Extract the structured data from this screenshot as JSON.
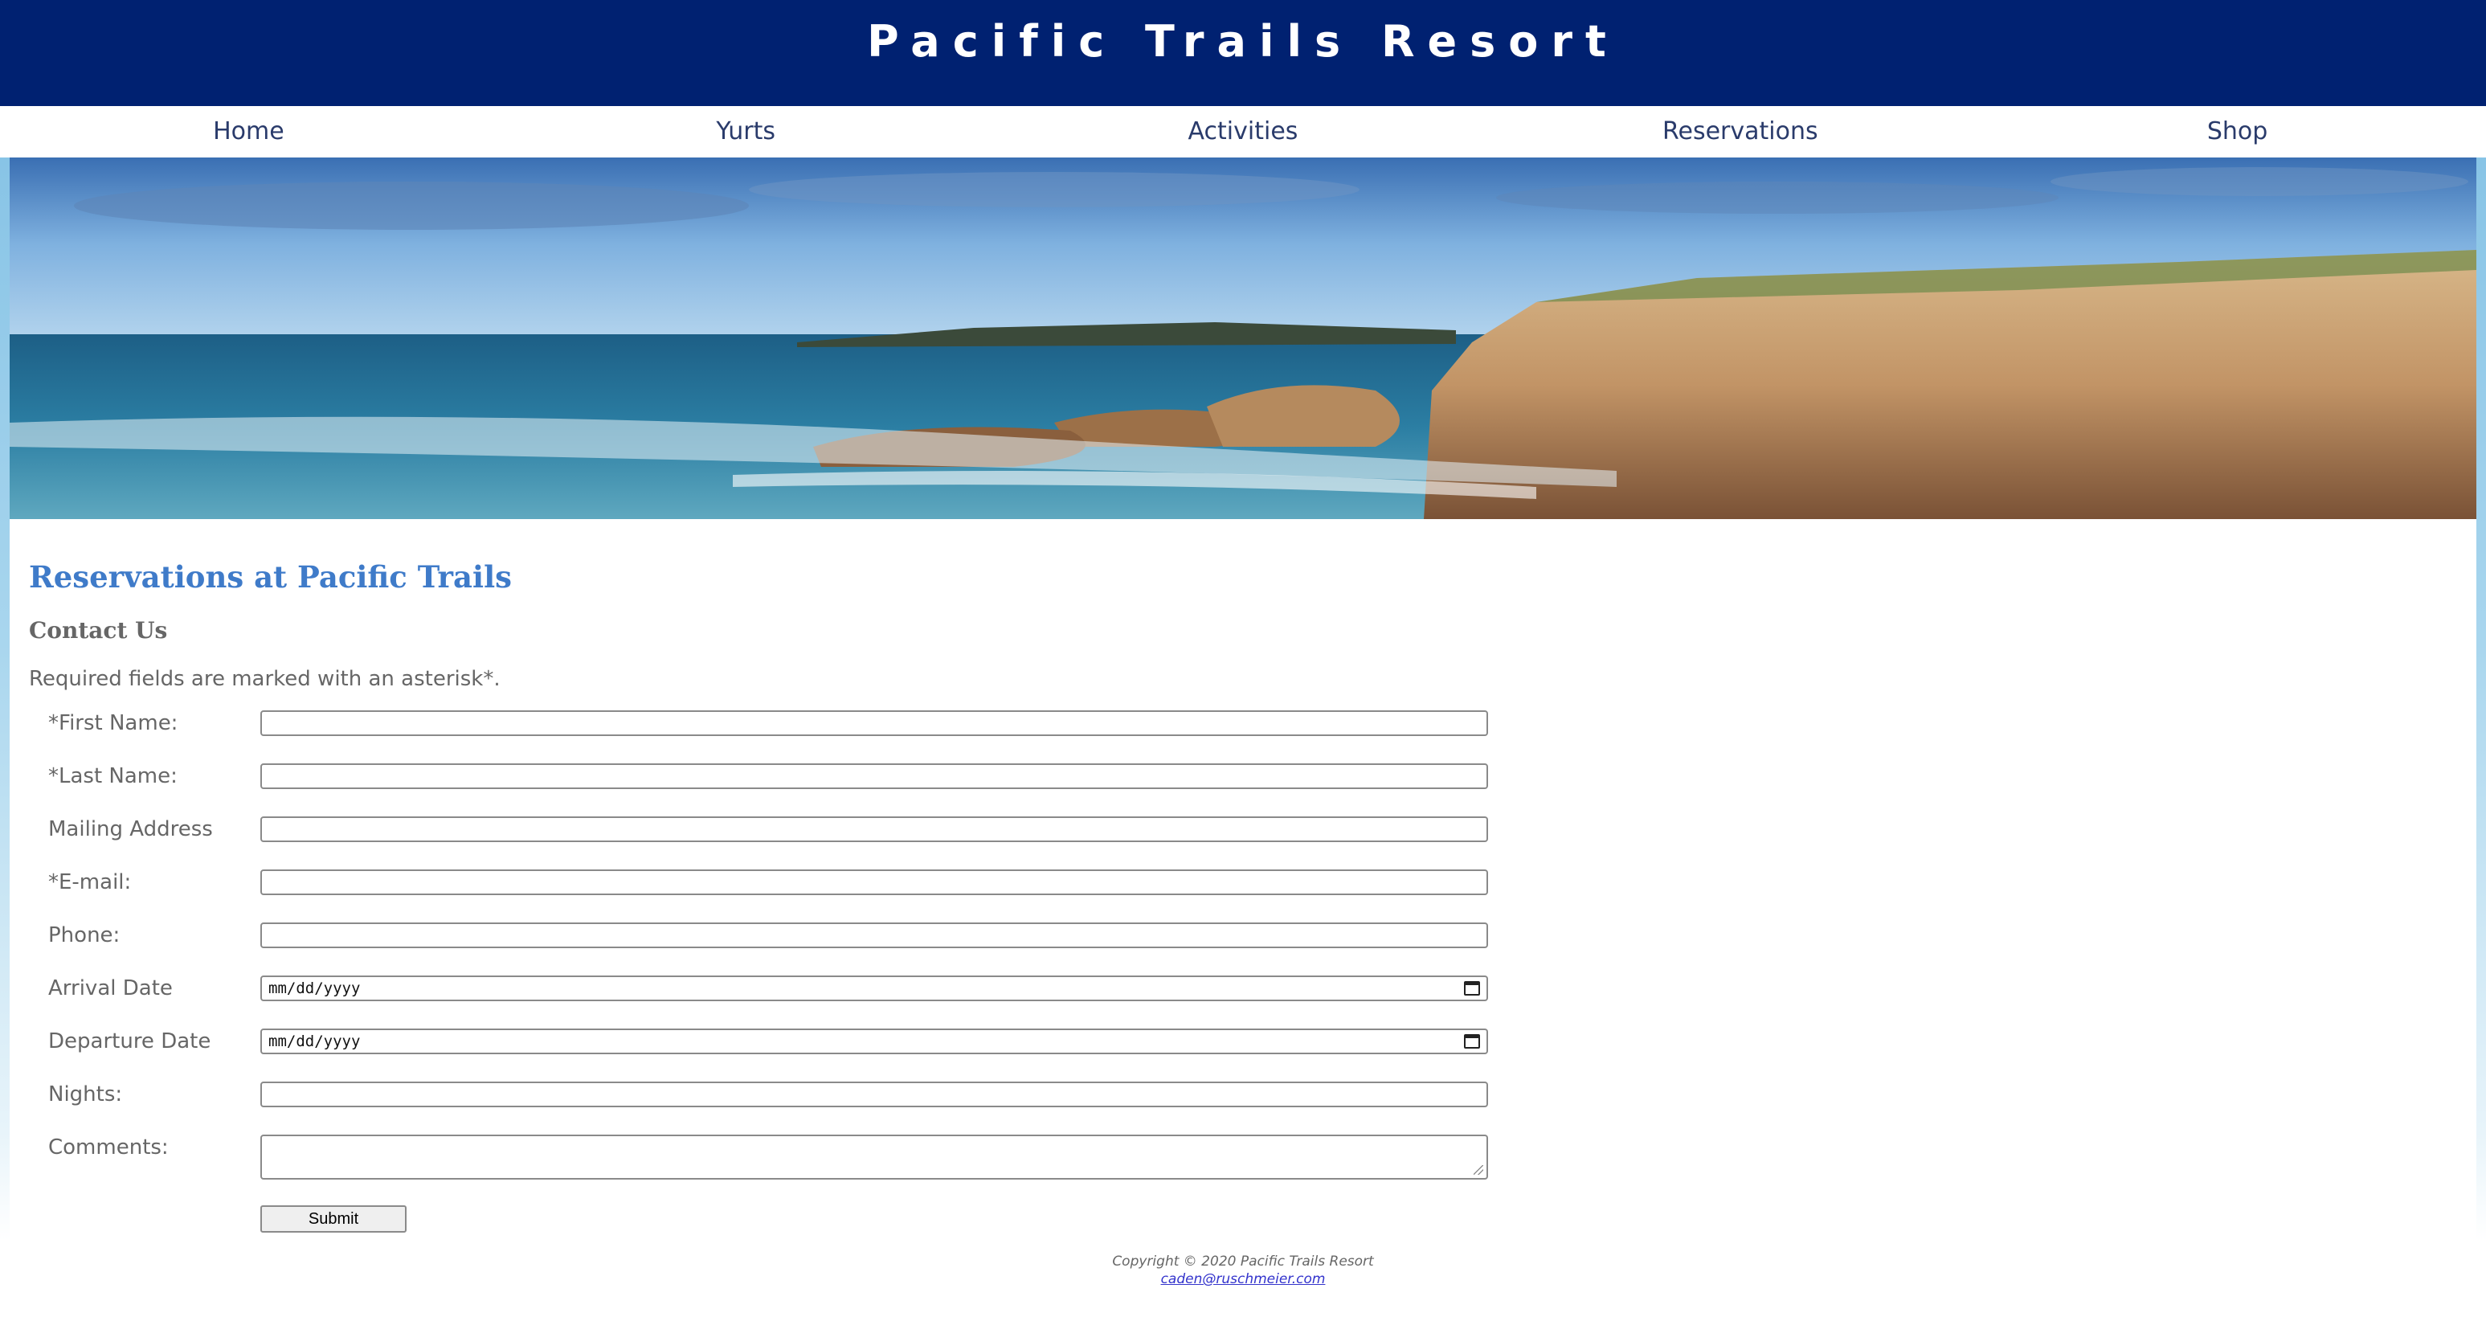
{
  "site": {
    "title": "Pacific Trails Resort"
  },
  "nav": {
    "items": [
      {
        "label": "Home"
      },
      {
        "label": "Yurts"
      },
      {
        "label": "Activities"
      },
      {
        "label": "Reservations"
      },
      {
        "label": "Shop"
      }
    ]
  },
  "main": {
    "heading": "Reservations at Pacific Trails",
    "subheading": "Contact Us",
    "required_note": "Required fields are marked with an asterisk*."
  },
  "form": {
    "first_name_label": "*First Name:",
    "last_name_label": "*Last Name:",
    "address_label": "Mailing Address",
    "email_label": "*E-mail:",
    "phone_label": "Phone:",
    "arrival_label": "Arrival Date",
    "arrival_placeholder": "mm/dd/yyyy",
    "departure_label": "Departure Date",
    "departure_placeholder": "mm/dd/yyyy",
    "nights_label": "Nights:",
    "comments_label": "Comments:",
    "submit_label": "Submit"
  },
  "footer": {
    "copyright": "Copyright © 2020 Pacific Trails Resort",
    "email": "caden@ruschmeier.com"
  },
  "colors": {
    "header_bg": "#002171",
    "heading": "#3f7bc9",
    "text": "#666666",
    "link": "#3333cc"
  },
  "icons": {
    "date_picker": "calendar-icon"
  }
}
